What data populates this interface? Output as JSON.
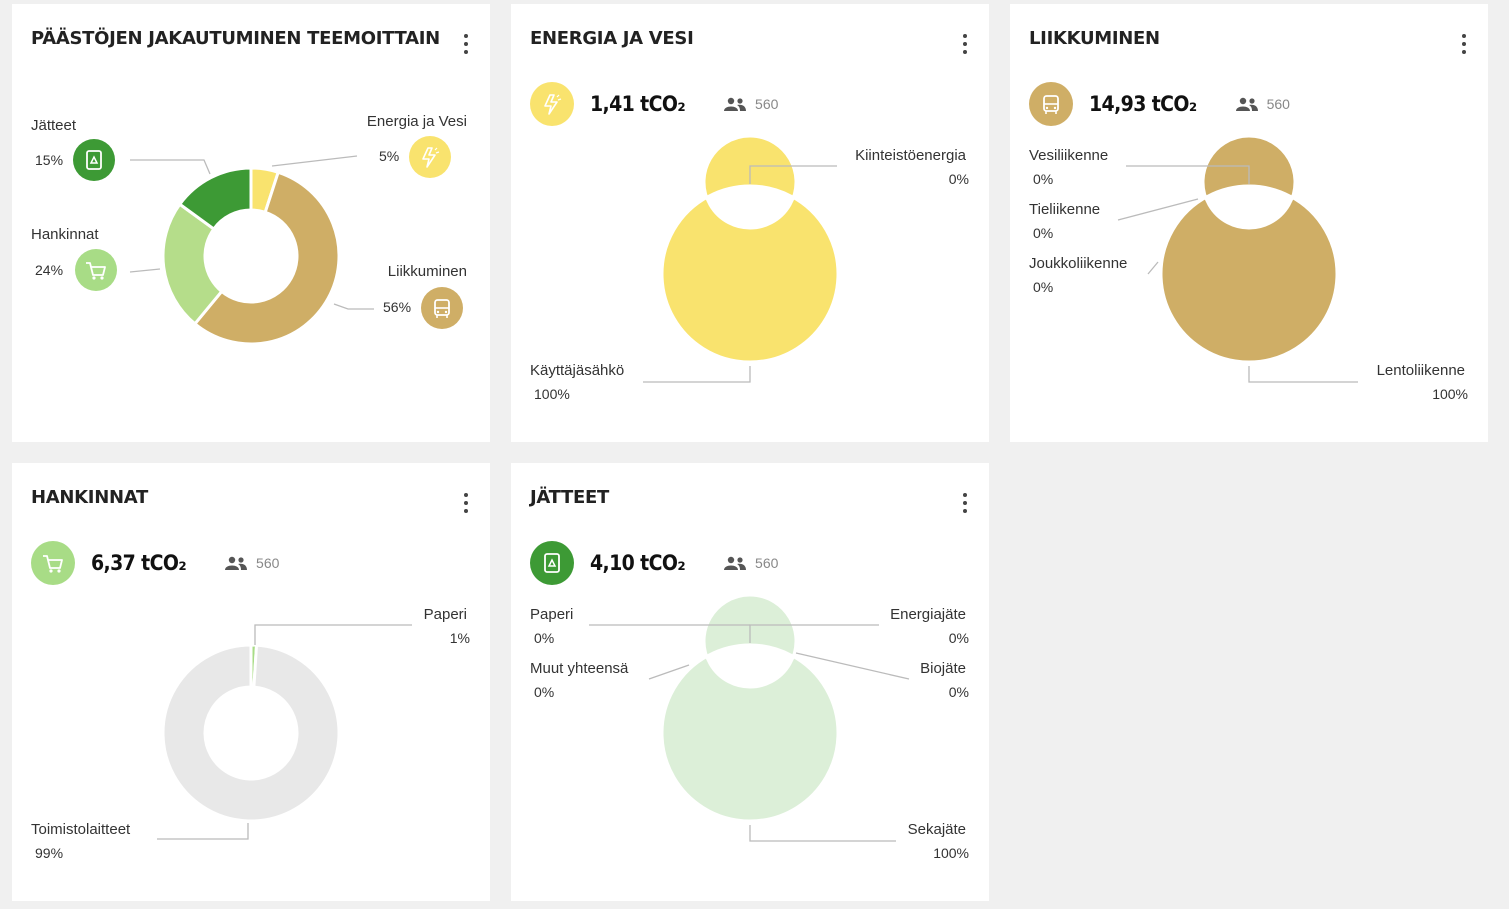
{
  "colors": {
    "jatteet": "#3d9a35",
    "hankinnat": "#b5dd8a",
    "liikkuminen": "#cfae66",
    "energia": "#f9e36e",
    "hankinnat_light": "#a8dc86",
    "grey": "#e8e8e8",
    "waste_light": "#dcefd8"
  },
  "overview": {
    "title": "PÄÄSTÖJEN JAKAUTUMINEN TEEMOITTAIN",
    "labels": {
      "jatteet": "Jätteet",
      "jatteet_pct": "15%",
      "energia": "Energia ja Vesi",
      "energia_pct": "5%",
      "hankinnat": "Hankinnat",
      "hankinnat_pct": "24%",
      "liikkuminen": "Liikkuminen",
      "liikkuminen_pct": "56%"
    }
  },
  "energia": {
    "title": "ENERGIA JA VESI",
    "value": "1,41 tCO₂",
    "people": "560",
    "labels": {
      "kiinteisto": "Kiinteistöenergia",
      "kiinteisto_pct": "0%",
      "kayttaja": "Käyttäjäsähkö",
      "kayttaja_pct": "100%"
    }
  },
  "liikkuminen": {
    "title": "LIIKKUMINEN",
    "value": "14,93 tCO₂",
    "people": "560",
    "labels": {
      "vesi": "Vesiliikenne",
      "vesi_pct": "0%",
      "tie": "Tieliikenne",
      "tie_pct": "0%",
      "joukko": "Joukkoliikenne",
      "joukko_pct": "0%",
      "lento": "Lentoliikenne",
      "lento_pct": "100%"
    }
  },
  "hankinnat": {
    "title": "HANKINNAT",
    "value": "6,37 tCO₂",
    "people": "560",
    "labels": {
      "paperi": "Paperi",
      "paperi_pct": "1%",
      "toimisto": "Toimistolaitteet",
      "toimisto_pct": "99%"
    }
  },
  "jatteet": {
    "title": "JÄTTEET",
    "value": "4,10 tCO₂",
    "people": "560",
    "labels": {
      "paperi": "Paperi",
      "paperi_pct": "0%",
      "muut": "Muut yhteensä",
      "muut_pct": "0%",
      "energiajate": "Energiajäte",
      "energiajate_pct": "0%",
      "biojate": "Biojäte",
      "biojate_pct": "0%",
      "sekajate": "Sekajäte",
      "sekajate_pct": "100%"
    }
  },
  "chart_data": [
    {
      "type": "pie",
      "title": "PÄÄSTÖJEN JAKAUTUMINEN TEEMOITTAIN",
      "categories": [
        "Energia ja Vesi",
        "Liikkuminen",
        "Hankinnat",
        "Jätteet"
      ],
      "values": [
        5,
        56,
        24,
        15
      ]
    },
    {
      "type": "pie",
      "title": "ENERGIA JA VESI",
      "categories": [
        "Kiinteistöenergia",
        "Käyttäjäsähkö"
      ],
      "values": [
        0,
        100
      ]
    },
    {
      "type": "pie",
      "title": "LIIKKUMINEN",
      "categories": [
        "Vesiliikenne",
        "Tieliikenne",
        "Joukkoliikenne",
        "Lentoliikenne"
      ],
      "values": [
        0,
        0,
        0,
        100
      ]
    },
    {
      "type": "pie",
      "title": "HANKINNAT",
      "categories": [
        "Paperi",
        "Toimistolaitteet"
      ],
      "values": [
        1,
        99
      ]
    },
    {
      "type": "pie",
      "title": "JÄTTEET",
      "categories": [
        "Paperi",
        "Muut yhteensä",
        "Energiajäte",
        "Biojäte",
        "Sekajäte"
      ],
      "values": [
        0,
        0,
        0,
        0,
        100
      ]
    }
  ]
}
